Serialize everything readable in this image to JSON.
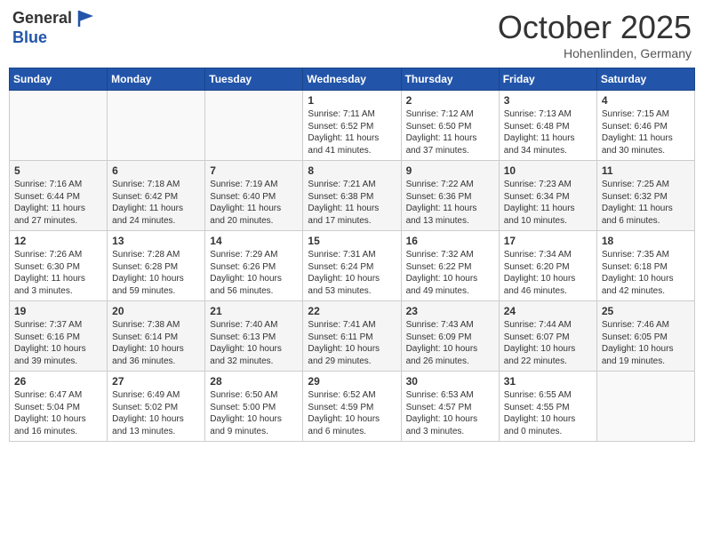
{
  "header": {
    "logo_line1": "General",
    "logo_line2": "Blue",
    "month": "October 2025",
    "location": "Hohenlinden, Germany"
  },
  "weekdays": [
    "Sunday",
    "Monday",
    "Tuesday",
    "Wednesday",
    "Thursday",
    "Friday",
    "Saturday"
  ],
  "weeks": [
    [
      {
        "day": "",
        "info": ""
      },
      {
        "day": "",
        "info": ""
      },
      {
        "day": "",
        "info": ""
      },
      {
        "day": "1",
        "info": "Sunrise: 7:11 AM\nSunset: 6:52 PM\nDaylight: 11 hours\nand 41 minutes."
      },
      {
        "day": "2",
        "info": "Sunrise: 7:12 AM\nSunset: 6:50 PM\nDaylight: 11 hours\nand 37 minutes."
      },
      {
        "day": "3",
        "info": "Sunrise: 7:13 AM\nSunset: 6:48 PM\nDaylight: 11 hours\nand 34 minutes."
      },
      {
        "day": "4",
        "info": "Sunrise: 7:15 AM\nSunset: 6:46 PM\nDaylight: 11 hours\nand 30 minutes."
      }
    ],
    [
      {
        "day": "5",
        "info": "Sunrise: 7:16 AM\nSunset: 6:44 PM\nDaylight: 11 hours\nand 27 minutes."
      },
      {
        "day": "6",
        "info": "Sunrise: 7:18 AM\nSunset: 6:42 PM\nDaylight: 11 hours\nand 24 minutes."
      },
      {
        "day": "7",
        "info": "Sunrise: 7:19 AM\nSunset: 6:40 PM\nDaylight: 11 hours\nand 20 minutes."
      },
      {
        "day": "8",
        "info": "Sunrise: 7:21 AM\nSunset: 6:38 PM\nDaylight: 11 hours\nand 17 minutes."
      },
      {
        "day": "9",
        "info": "Sunrise: 7:22 AM\nSunset: 6:36 PM\nDaylight: 11 hours\nand 13 minutes."
      },
      {
        "day": "10",
        "info": "Sunrise: 7:23 AM\nSunset: 6:34 PM\nDaylight: 11 hours\nand 10 minutes."
      },
      {
        "day": "11",
        "info": "Sunrise: 7:25 AM\nSunset: 6:32 PM\nDaylight: 11 hours\nand 6 minutes."
      }
    ],
    [
      {
        "day": "12",
        "info": "Sunrise: 7:26 AM\nSunset: 6:30 PM\nDaylight: 11 hours\nand 3 minutes."
      },
      {
        "day": "13",
        "info": "Sunrise: 7:28 AM\nSunset: 6:28 PM\nDaylight: 10 hours\nand 59 minutes."
      },
      {
        "day": "14",
        "info": "Sunrise: 7:29 AM\nSunset: 6:26 PM\nDaylight: 10 hours\nand 56 minutes."
      },
      {
        "day": "15",
        "info": "Sunrise: 7:31 AM\nSunset: 6:24 PM\nDaylight: 10 hours\nand 53 minutes."
      },
      {
        "day": "16",
        "info": "Sunrise: 7:32 AM\nSunset: 6:22 PM\nDaylight: 10 hours\nand 49 minutes."
      },
      {
        "day": "17",
        "info": "Sunrise: 7:34 AM\nSunset: 6:20 PM\nDaylight: 10 hours\nand 46 minutes."
      },
      {
        "day": "18",
        "info": "Sunrise: 7:35 AM\nSunset: 6:18 PM\nDaylight: 10 hours\nand 42 minutes."
      }
    ],
    [
      {
        "day": "19",
        "info": "Sunrise: 7:37 AM\nSunset: 6:16 PM\nDaylight: 10 hours\nand 39 minutes."
      },
      {
        "day": "20",
        "info": "Sunrise: 7:38 AM\nSunset: 6:14 PM\nDaylight: 10 hours\nand 36 minutes."
      },
      {
        "day": "21",
        "info": "Sunrise: 7:40 AM\nSunset: 6:13 PM\nDaylight: 10 hours\nand 32 minutes."
      },
      {
        "day": "22",
        "info": "Sunrise: 7:41 AM\nSunset: 6:11 PM\nDaylight: 10 hours\nand 29 minutes."
      },
      {
        "day": "23",
        "info": "Sunrise: 7:43 AM\nSunset: 6:09 PM\nDaylight: 10 hours\nand 26 minutes."
      },
      {
        "day": "24",
        "info": "Sunrise: 7:44 AM\nSunset: 6:07 PM\nDaylight: 10 hours\nand 22 minutes."
      },
      {
        "day": "25",
        "info": "Sunrise: 7:46 AM\nSunset: 6:05 PM\nDaylight: 10 hours\nand 19 minutes."
      }
    ],
    [
      {
        "day": "26",
        "info": "Sunrise: 6:47 AM\nSunset: 5:04 PM\nDaylight: 10 hours\nand 16 minutes."
      },
      {
        "day": "27",
        "info": "Sunrise: 6:49 AM\nSunset: 5:02 PM\nDaylight: 10 hours\nand 13 minutes."
      },
      {
        "day": "28",
        "info": "Sunrise: 6:50 AM\nSunset: 5:00 PM\nDaylight: 10 hours\nand 9 minutes."
      },
      {
        "day": "29",
        "info": "Sunrise: 6:52 AM\nSunset: 4:59 PM\nDaylight: 10 hours\nand 6 minutes."
      },
      {
        "day": "30",
        "info": "Sunrise: 6:53 AM\nSunset: 4:57 PM\nDaylight: 10 hours\nand 3 minutes."
      },
      {
        "day": "31",
        "info": "Sunrise: 6:55 AM\nSunset: 4:55 PM\nDaylight: 10 hours\nand 0 minutes."
      },
      {
        "day": "",
        "info": ""
      }
    ]
  ]
}
